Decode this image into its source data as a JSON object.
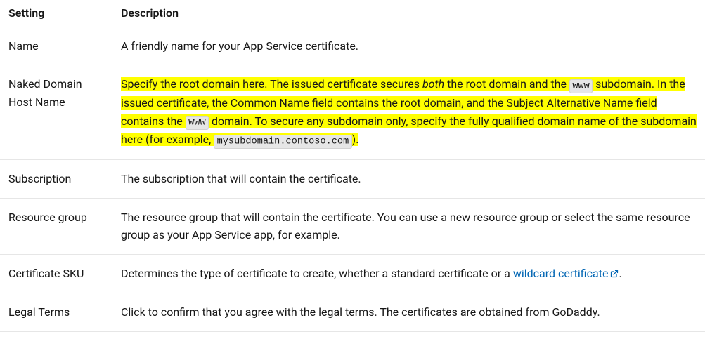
{
  "headers": {
    "setting": "Setting",
    "description": "Description"
  },
  "rows": {
    "name": {
      "setting": "Name",
      "desc": "A friendly name for your App Service certificate."
    },
    "naked": {
      "setting": "Naked Domain Host Name",
      "desc_part1": "Specify the root domain here. The issued certificate secures ",
      "desc_both": "both",
      "desc_part2": " the root domain and the ",
      "code_www1": "www",
      "desc_part3": " subdomain. In the issued certificate, the Common Name field contains the root domain, and the Subject Alternative Name field contains the ",
      "code_www2": "www",
      "desc_part4": " domain. To secure any subdomain only, specify the fully qualified domain name of the subdomain here (for example, ",
      "code_sub": "mysubdomain.contoso.com",
      "desc_part5": ")."
    },
    "subscription": {
      "setting": "Subscription",
      "desc": "The subscription that will contain the certificate."
    },
    "rg": {
      "setting": "Resource group",
      "desc": "The resource group that will contain the certificate. You can use a new resource group or select the same resource group as your App Service app, for example."
    },
    "sku": {
      "setting": "Certificate SKU",
      "desc_part1": "Determines the type of certificate to create, whether a standard certificate or a ",
      "link_text": "wildcard certificate",
      "desc_part2": "."
    },
    "legal": {
      "setting": "Legal Terms",
      "desc": "Click to confirm that you agree with the legal terms. The certificates are obtained from GoDaddy."
    }
  }
}
